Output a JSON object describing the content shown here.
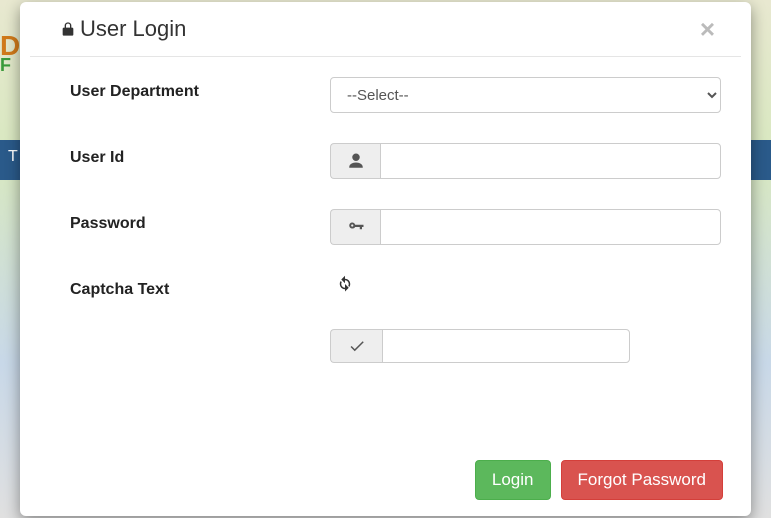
{
  "header": {
    "title": "User Login"
  },
  "form": {
    "department": {
      "label": "User Department",
      "selected": "--Select--"
    },
    "userId": {
      "label": "User Id",
      "value": ""
    },
    "password": {
      "label": "Password",
      "value": ""
    },
    "captchaLabel": "Captcha Text",
    "captchaInput": {
      "value": ""
    }
  },
  "footer": {
    "login": "Login",
    "forgot": "Forgot Password"
  }
}
